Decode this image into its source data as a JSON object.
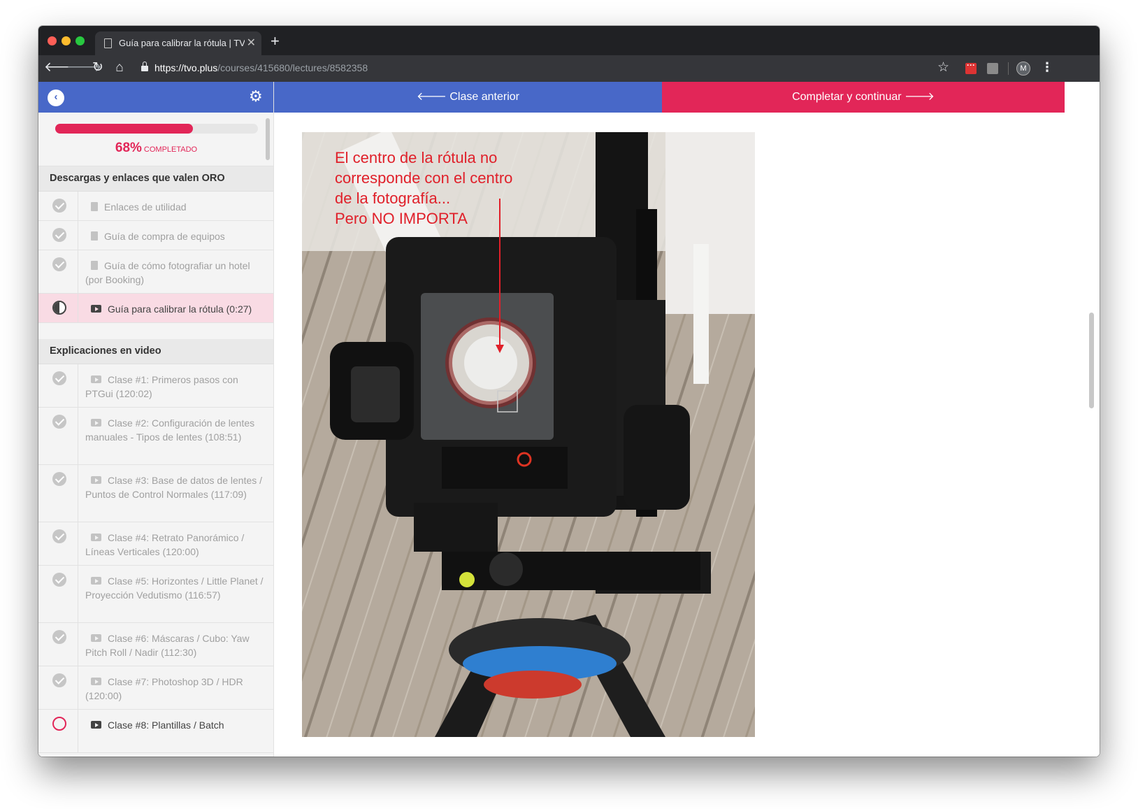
{
  "browser": {
    "tab_title": "Guía para calibrar la rótula | TV",
    "tab_close": "✕",
    "new_tab": "+",
    "url_host": "https://tvo.plus",
    "url_path": "/courses/415680/lectures/8582358",
    "avatar_letter": "M"
  },
  "sidebar": {
    "progress_percent": 68,
    "progress_label": "68%",
    "progress_suffix": "COMPLETADO",
    "section1_title": "Descargas y enlaces que valen ORO",
    "section1_items": [
      {
        "label": "Enlaces de utilidad",
        "type": "file",
        "status": "done"
      },
      {
        "label": "Guía de compra de equipos",
        "type": "file",
        "status": "done"
      },
      {
        "label": "Guía de cómo fotografiar un hotel (por Booking)",
        "type": "file",
        "status": "done"
      },
      {
        "label": "Guía para calibrar la rótula (0:27)",
        "type": "video",
        "status": "half",
        "active": true
      }
    ],
    "section2_title": "Explicaciones en video",
    "section2_items": [
      {
        "label": "Clase #1: Primeros pasos con PTGui (120:02)",
        "type": "video",
        "status": "done"
      },
      {
        "label": "Clase #2: Configuración de lentes manuales - Tipos de lentes (108:51)",
        "type": "video",
        "status": "done"
      },
      {
        "label": "Clase #3: Base de datos de lentes / Puntos de Control Normales (117:09)",
        "type": "video",
        "status": "done"
      },
      {
        "label": "Clase #4: Retrato Panorámico / Líneas Verticales (120:00)",
        "type": "video",
        "status": "done"
      },
      {
        "label": "Clase #5: Horizontes / Little Planet / Proyección Vedutismo (116:57)",
        "type": "video",
        "status": "done"
      },
      {
        "label": "Clase #6: Máscaras / Cubo: Yaw Pitch Roll / Nadir (112:30)",
        "type": "video",
        "status": "done"
      },
      {
        "label": "Clase #7: Photoshop 3D / HDR (120:00)",
        "type": "video",
        "status": "done"
      },
      {
        "label": "Clase #8: Plantillas / Batch",
        "type": "video",
        "status": "empty"
      }
    ]
  },
  "main": {
    "prev_button": "🡐 Clase anterior",
    "next_button": "Completar y continuar 🡒",
    "annotation_lines": [
      "El centro de la rótula no",
      "corresponde con el centro",
      "de la fotografía...",
      "Pero NO IMPORTA"
    ]
  },
  "colors": {
    "accent_blue": "#4868c8",
    "accent_pink": "#e22658",
    "annotation_red": "#e0202a"
  },
  "icons": {
    "back": "arrow-left-icon",
    "forward": "arrow-right-icon",
    "reload": "reload-icon",
    "home": "home-icon",
    "bookmark": "star-icon",
    "settings": "gear-icon"
  }
}
